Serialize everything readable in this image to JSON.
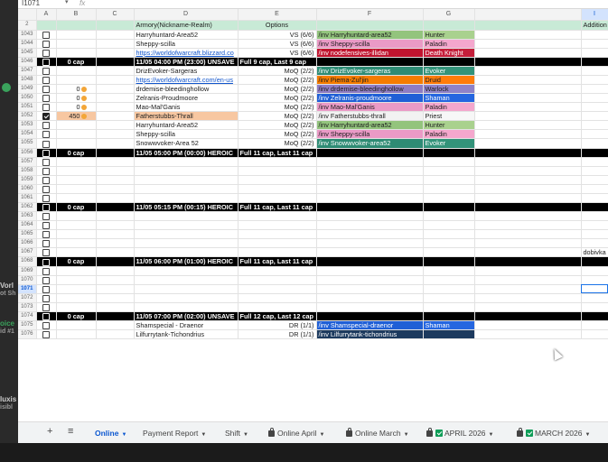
{
  "formula_bar": {
    "cell_ref": "I1071",
    "fx": "fx"
  },
  "columns": [
    "A",
    "B",
    "C",
    "D",
    "E",
    "F",
    "G",
    "",
    "I"
  ],
  "frozen_row": {
    "row_num": "2",
    "d": "Armory(Nickname-Realm)",
    "e": "Options",
    "i": "Addition option"
  },
  "rows": [
    {
      "n": "1043",
      "d": "Harryhuntard-Area52",
      "e": "VS (6/6)",
      "f": "/inv Harryhuntard-area52",
      "g": "Hunter",
      "fc": "#93c47d",
      "gc": "#a9d18e"
    },
    {
      "n": "1044",
      "d": "Sheppy-scilla",
      "e": "VS (6/6)",
      "f": "/inv Sheppy-scilla",
      "g": "Paladin",
      "fc": "#ea9ac6",
      "gc": "#f4a7cd"
    },
    {
      "n": "1045",
      "d": "https://worldofwarcraft.blizzard.co",
      "e": "VS (6/6)",
      "f": "/inv nodefensives-illidan",
      "g": "Death Knight",
      "fc": "#c0142f",
      "gc": "#c41e3a",
      "link": true,
      "white": true
    },
    {
      "n": "1046",
      "dark": true,
      "b": "0 cap",
      "d": "11/05 04:00 PM (23:00) UNSAVE",
      "e": "Full 9 cap, Last 9 cap"
    },
    {
      "n": "1047",
      "d": "DrizEvoker-Sargeras",
      "e": "MoQ (2/2)",
      "f": "/inv DrizEvoker-sargeras",
      "g": "Evoker",
      "fc": "#2e8b74",
      "gc": "#33937a",
      "white": true
    },
    {
      "n": "1048",
      "d": "https://worldofwarcraft.com/en-us",
      "e": "MoQ (2/2)",
      "f": "/inv Piema-Zul'jin",
      "g": "Druid",
      "fc": "#f57c00",
      "gc": "#ff7c0a",
      "link": true
    },
    {
      "n": "1049",
      "b": "0",
      "coin": true,
      "d": "drdemise-bleedinghollow",
      "e": "MoQ (2/2)",
      "f": "/inv drdemise-bleedinghollow",
      "g": "Warlock",
      "fc": "#8e7cc3",
      "gc": "#8f82c8"
    },
    {
      "n": "1050",
      "b": "0",
      "coin": true,
      "d": "Zelranis-Proudmoore",
      "e": "MoQ (2/2)",
      "f": "/inv Zelranis-proudmoore",
      "g": "Shaman",
      "fc": "#1f5fd6",
      "gc": "#2566e0",
      "white": true
    },
    {
      "n": "1051",
      "b": "0",
      "coin": true,
      "d": "Mao-Mal'Ganis",
      "e": "MoQ (2/2)",
      "f": "/inv Mao-Mal'Ganis",
      "g": "Paladin",
      "fc": "#ea9ac6",
      "gc": "#f4a7cd"
    },
    {
      "n": "1052",
      "checked": true,
      "b": "450",
      "coin": true,
      "peach": true,
      "d": "Fatherstubbs-Thrall",
      "e": "MoQ (2/2)",
      "f": "/inv Fatherstubbs-thrall",
      "g": "Priest",
      "fc": "#f2f2f2",
      "gc": "#f7f7f7"
    },
    {
      "n": "1053",
      "d": "Harryhuntard-Area52",
      "e": "MoQ (2/2)",
      "f": "/inv Harryhuntard-area52",
      "g": "Hunter",
      "fc": "#93c47d",
      "gc": "#a9d18e"
    },
    {
      "n": "1054",
      "d": "Sheppy-scilla",
      "e": "MoQ (2/2)",
      "f": "/inv Sheppy-scilla",
      "g": "Paladin",
      "fc": "#ea9ac6",
      "gc": "#f4a7cd"
    },
    {
      "n": "1055",
      "d": "Snowwvoker-Area 52",
      "e": "MoQ (2/2)",
      "f": "/inv Snowwvoker-area52",
      "g": "Evoker",
      "fc": "#2e8b74",
      "gc": "#33937a",
      "white": true
    },
    {
      "n": "1056",
      "dark": true,
      "b": "0 cap",
      "d": "11/05 05:00 PM (00:00) HEROIC",
      "e": "Full 11 cap, Last 11 cap"
    },
    {
      "n": "1057"
    },
    {
      "n": "1058"
    },
    {
      "n": "1059"
    },
    {
      "n": "1060"
    },
    {
      "n": "1061"
    },
    {
      "n": "1062",
      "dark": true,
      "b": "0 cap",
      "d": "11/05 05:15 PM (00:15) HEROIC",
      "e": "Full 11 cap, Last 11 cap"
    },
    {
      "n": "1063"
    },
    {
      "n": "1064"
    },
    {
      "n": "1065"
    },
    {
      "n": "1066"
    },
    {
      "n": "1067",
      "i": "dobivka"
    },
    {
      "n": "1068",
      "dark": true,
      "b": "0 cap",
      "d": "11/05 06:00 PM (01:00) HEROIC",
      "e": "Full 11 cap, Last 11 cap"
    },
    {
      "n": "1069"
    },
    {
      "n": "1070"
    },
    {
      "n": "1071",
      "selected": true
    },
    {
      "n": "1072"
    },
    {
      "n": "1073"
    },
    {
      "n": "1074",
      "dark": true,
      "b": "0 cap",
      "d": "11/05 07:00 PM (02:00) UNSAVE",
      "e": "Full 12 cap, Last 12 cap"
    },
    {
      "n": "1075",
      "d": "Shamspecial - Draenor",
      "e": "DR (1/1)",
      "f": "/inv Shamspecial-draenor",
      "g": "Shaman",
      "fc": "#1f5fd6",
      "gc": "#2566e0",
      "white": true
    },
    {
      "n": "1076",
      "d": "Lilfurrytank-Tichondrius",
      "e": "DR (1/1)",
      "f": "/inv Lilfurrytank-tichondrius",
      "g": "",
      "fc": "#1c3a5e",
      "gc": "#1c3a5e",
      "white": true
    }
  ],
  "tabs": {
    "add": "+",
    "menu": "≡",
    "items": [
      {
        "label": "Online",
        "active": true,
        "lock": false,
        "check": false
      },
      {
        "label": "Payment Report",
        "active": false,
        "lock": false,
        "check": false
      },
      {
        "label": "Shift",
        "active": false,
        "lock": false,
        "check": false
      },
      {
        "label": "Online April",
        "active": false,
        "lock": true,
        "check": false
      },
      {
        "label": "Online March",
        "active": false,
        "lock": true,
        "check": false
      },
      {
        "label": "APRIL 2026",
        "active": false,
        "lock": true,
        "check": true
      },
      {
        "label": "MARCH 2026",
        "active": false,
        "lock": true,
        "check": true
      }
    ]
  },
  "background_text": {
    "a": "Vorl",
    "b": "ot Sh",
    "c": "oice",
    "d": "id #1",
    "e": "luxis",
    "f": "isibl"
  },
  "colors": {
    "accent": "#0b57d0",
    "frozen_row": "#c8ead6",
    "dark_row": "#000000"
  }
}
